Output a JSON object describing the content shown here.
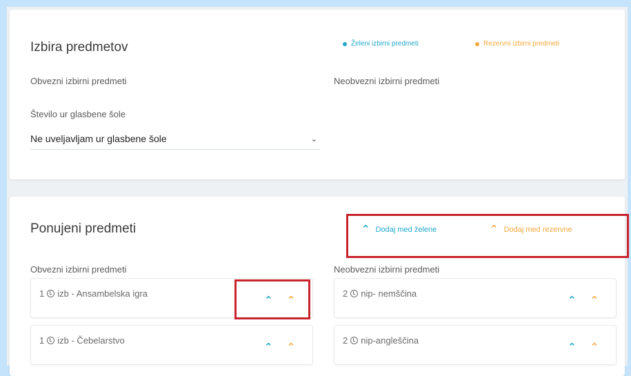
{
  "colors": {
    "green": "#21a8c9",
    "orange": "#f2a93b",
    "highlight": "#c8232c"
  },
  "selection": {
    "title": "Izbira predmetov",
    "legend_green": "Želeni izbirni predmeti",
    "legend_orange": "Rezervni izbirni predmeti",
    "mandatory_label": "Obvezni izbirni predmeti",
    "optional_label": "Neobvezni izbirni predmeti",
    "music_label": "Število ur glasbene šole",
    "music_select_value": "Ne uveljavljam ur glasbene šole"
  },
  "offered": {
    "title": "Ponujeni predmeti",
    "add_green": "Dodaj med želene",
    "add_orange": "Dodaj med rezervne",
    "mandatory_label": "Obvezni izbirni predmeti",
    "optional_label": "Neobvezni izbirni predmeti",
    "mandatory_items": [
      {
        "hours": "1",
        "name": "izb - Ansambelska igra"
      },
      {
        "hours": "1",
        "name": "izb - Čebelarstvo"
      }
    ],
    "optional_items": [
      {
        "hours": "2",
        "name": "nip- nemščina"
      },
      {
        "hours": "2",
        "name": "nip-angleščina"
      }
    ]
  }
}
